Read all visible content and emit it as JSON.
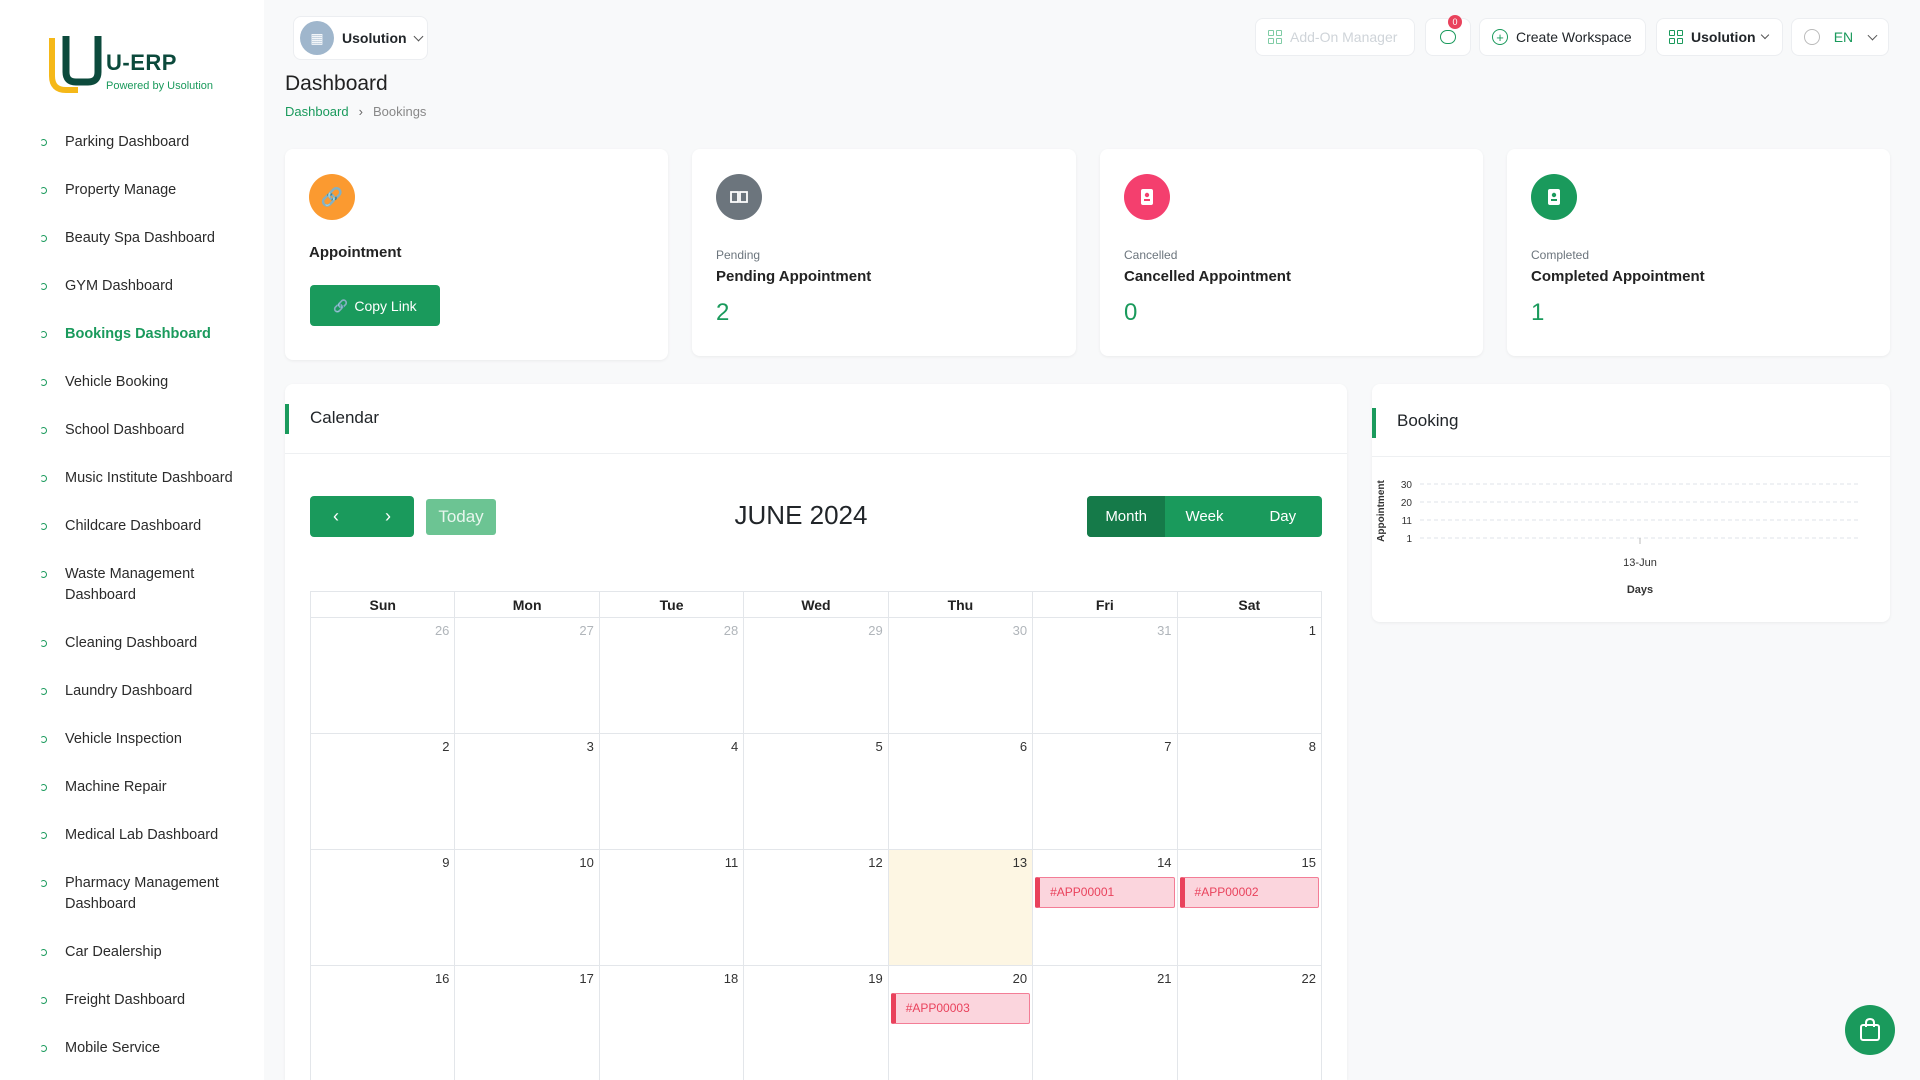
{
  "brand": {
    "name": "U-ERP",
    "tagline": "Powered by Usolution"
  },
  "sidebar": {
    "items": [
      {
        "label": "Parking Dashboard"
      },
      {
        "label": "Property Manage"
      },
      {
        "label": "Beauty Spa Dashboard"
      },
      {
        "label": "GYM Dashboard"
      },
      {
        "label": "Bookings Dashboard",
        "active": true
      },
      {
        "label": "Vehicle Booking"
      },
      {
        "label": "School Dashboard"
      },
      {
        "label": "Music Institute Dashboard"
      },
      {
        "label": "Childcare Dashboard"
      },
      {
        "label": "Waste Management Dashboard"
      },
      {
        "label": "Cleaning Dashboard"
      },
      {
        "label": "Laundry Dashboard"
      },
      {
        "label": "Vehicle Inspection"
      },
      {
        "label": "Machine Repair"
      },
      {
        "label": "Medical Lab Dashboard"
      },
      {
        "label": "Pharmacy Management Dashboard"
      },
      {
        "label": "Car Dealership"
      },
      {
        "label": "Freight Dashboard"
      },
      {
        "label": "Mobile Service"
      }
    ]
  },
  "topbar": {
    "workspace": "Usolution",
    "addon_label": "Add-On Manager",
    "chat_badge": "0",
    "create_label": "Create Workspace",
    "user_workspace": "Usolution",
    "language": "EN"
  },
  "header": {
    "title": "Dashboard",
    "breadcrumb": {
      "home": "Dashboard",
      "current": "Bookings"
    }
  },
  "cards": {
    "appointment": {
      "label": "Appointment",
      "button": "Copy Link"
    },
    "pending": {
      "small": "Pending",
      "label": "Pending Appointment",
      "value": "2"
    },
    "cancelled": {
      "small": "Cancelled",
      "label": "Cancelled Appointment",
      "value": "0"
    },
    "completed": {
      "small": "Completed",
      "label": "Completed Appointment",
      "value": "1"
    }
  },
  "colors": {
    "accent": "#1a9a5c",
    "orange": "#fb9a30",
    "gray": "#6c757d",
    "pink": "#f43f6e",
    "event": "#e9425c"
  },
  "calendar": {
    "section_title": "Calendar",
    "title": "JUNE 2024",
    "today_label": "Today",
    "views": [
      "Month",
      "Week",
      "Day"
    ],
    "active_view": "Month",
    "weekdays": [
      "Sun",
      "Mon",
      "Tue",
      "Wed",
      "Thu",
      "Fri",
      "Sat"
    ],
    "weeks": [
      [
        {
          "d": "26",
          "m": true
        },
        {
          "d": "27",
          "m": true
        },
        {
          "d": "28",
          "m": true
        },
        {
          "d": "29",
          "m": true
        },
        {
          "d": "30",
          "m": true
        },
        {
          "d": "31",
          "m": true
        },
        {
          "d": "1"
        }
      ],
      [
        {
          "d": "2"
        },
        {
          "d": "3"
        },
        {
          "d": "4"
        },
        {
          "d": "5"
        },
        {
          "d": "6"
        },
        {
          "d": "7"
        },
        {
          "d": "8"
        }
      ],
      [
        {
          "d": "9"
        },
        {
          "d": "10"
        },
        {
          "d": "11"
        },
        {
          "d": "12"
        },
        {
          "d": "13",
          "today": true
        },
        {
          "d": "14",
          "event": "#APP00001"
        },
        {
          "d": "15",
          "event": "#APP00002"
        }
      ],
      [
        {
          "d": "16"
        },
        {
          "d": "17"
        },
        {
          "d": "18"
        },
        {
          "d": "19"
        },
        {
          "d": "20",
          "event": "#APP00003"
        },
        {
          "d": "21"
        },
        {
          "d": "22"
        }
      ]
    ]
  },
  "booking": {
    "section_title": "Booking",
    "chart_data": {
      "type": "line",
      "title": "",
      "xlabel": "Days",
      "ylabel": "Appointment",
      "categories": [
        "13-Jun"
      ],
      "y_ticks": [
        "30",
        "20",
        "11",
        "1"
      ],
      "grid": true,
      "series": []
    }
  }
}
